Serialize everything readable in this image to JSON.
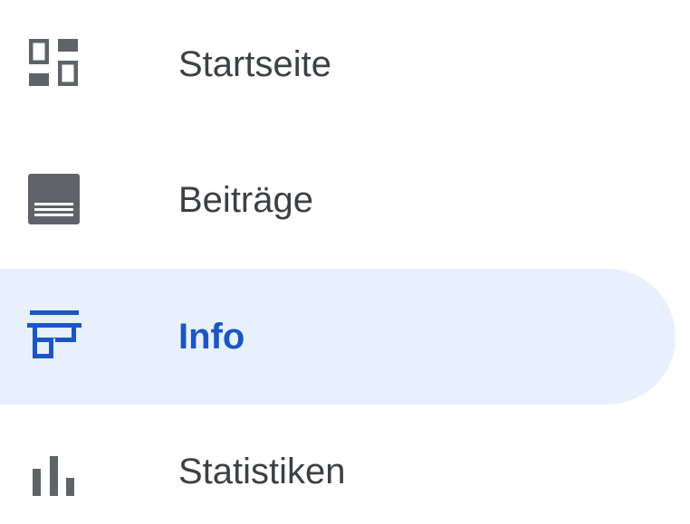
{
  "colors": {
    "icon_default": "#5f6368",
    "text_default": "#3c4043",
    "active_background": "#e8f0fe",
    "active_accent": "#1a56c4"
  },
  "nav": {
    "items": [
      {
        "label": "Startseite",
        "icon": "dashboard-icon",
        "active": false
      },
      {
        "label": "Beiträge",
        "icon": "posts-icon",
        "active": false
      },
      {
        "label": "Info",
        "icon": "storefront-icon",
        "active": true
      },
      {
        "label": "Statistiken",
        "icon": "bar-chart-icon",
        "active": false
      }
    ]
  }
}
